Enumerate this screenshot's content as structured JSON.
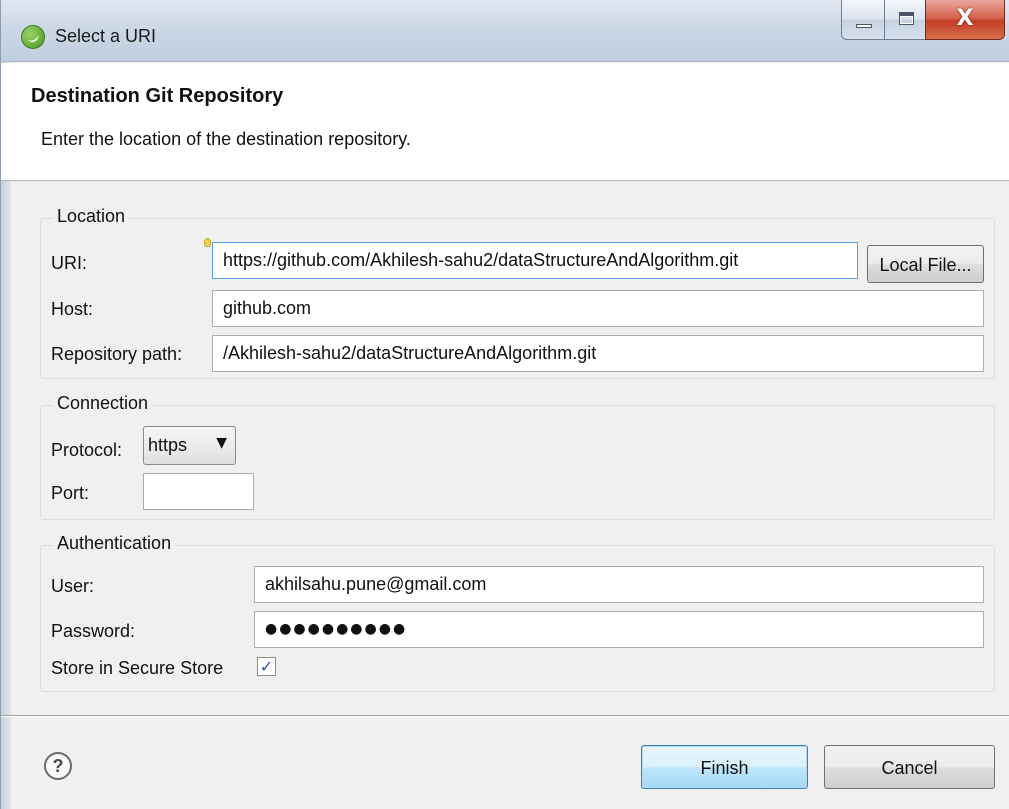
{
  "window": {
    "title": "Select a URI",
    "icon": "spring-leaf-icon"
  },
  "header": {
    "heading": "Destination Git Repository",
    "description": "Enter the location of the destination repository."
  },
  "location": {
    "group_title": "Location",
    "uri_label": "URI:",
    "uri_value": "https://github.com/Akhilesh-sahu2/dataStructureAndAlgorithm.git",
    "local_file_button": "Local File...",
    "host_label": "Host:",
    "host_value": "github.com",
    "repo_path_label": "Repository path:",
    "repo_path_value": "/Akhilesh-sahu2/dataStructureAndAlgorithm.git"
  },
  "connection": {
    "group_title": "Connection",
    "protocol_label": "Protocol:",
    "protocol_value": "https",
    "port_label": "Port:",
    "port_value": ""
  },
  "authentication": {
    "group_title": "Authentication",
    "user_label": "User:",
    "user_value": "akhilsahu.pune@gmail.com",
    "password_label": "Password:",
    "password_mask": "●●●●●●●●●●",
    "store_label": "Store in Secure Store",
    "store_checked": true
  },
  "footer": {
    "help_glyph": "?",
    "finish_label": "Finish",
    "cancel_label": "Cancel"
  },
  "colors": {
    "accent": "#3c7fb1",
    "focus_border": "#569de5",
    "close_button": "#c43e25"
  }
}
